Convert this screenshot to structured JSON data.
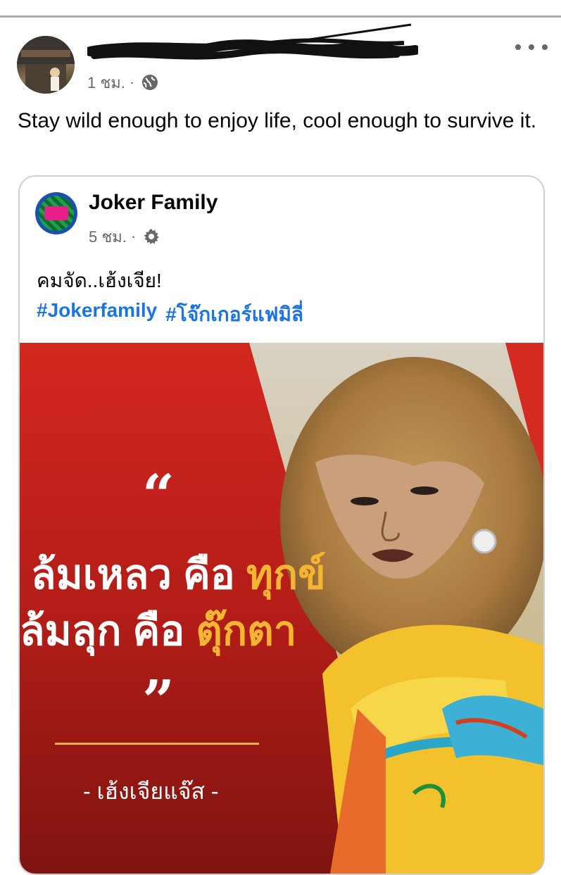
{
  "post": {
    "time": "1 ชม.",
    "separator": "·",
    "privacy_icon": "globe-icon",
    "more_icon": "more-options-icon",
    "text": "Stay wild enough to enjoy life, cool enough to survive it."
  },
  "shared_post": {
    "page_name": "Joker Family",
    "time": "5 ชม.",
    "separator": "·",
    "privacy_icon": "gear-icon",
    "text": "คมจัด..เฮ้งเจีย!",
    "hashtags": [
      "#Jokerfamily",
      "#โจ๊กเกอร์แฟมิลี่"
    ]
  },
  "media": {
    "quote_open": "“",
    "line1_a": "ล้มเหลว คือ ",
    "line1_b": "ทุกข์",
    "line2_a": "ล้มลุก คือ ",
    "line2_b": "ตุ๊กตา",
    "quote_close": "”",
    "attribution": "- เฮ้งเจียแจ๊ส -",
    "colors": {
      "background": "#c8221b",
      "highlight": "#f6b433",
      "text": "#ffffff"
    }
  }
}
